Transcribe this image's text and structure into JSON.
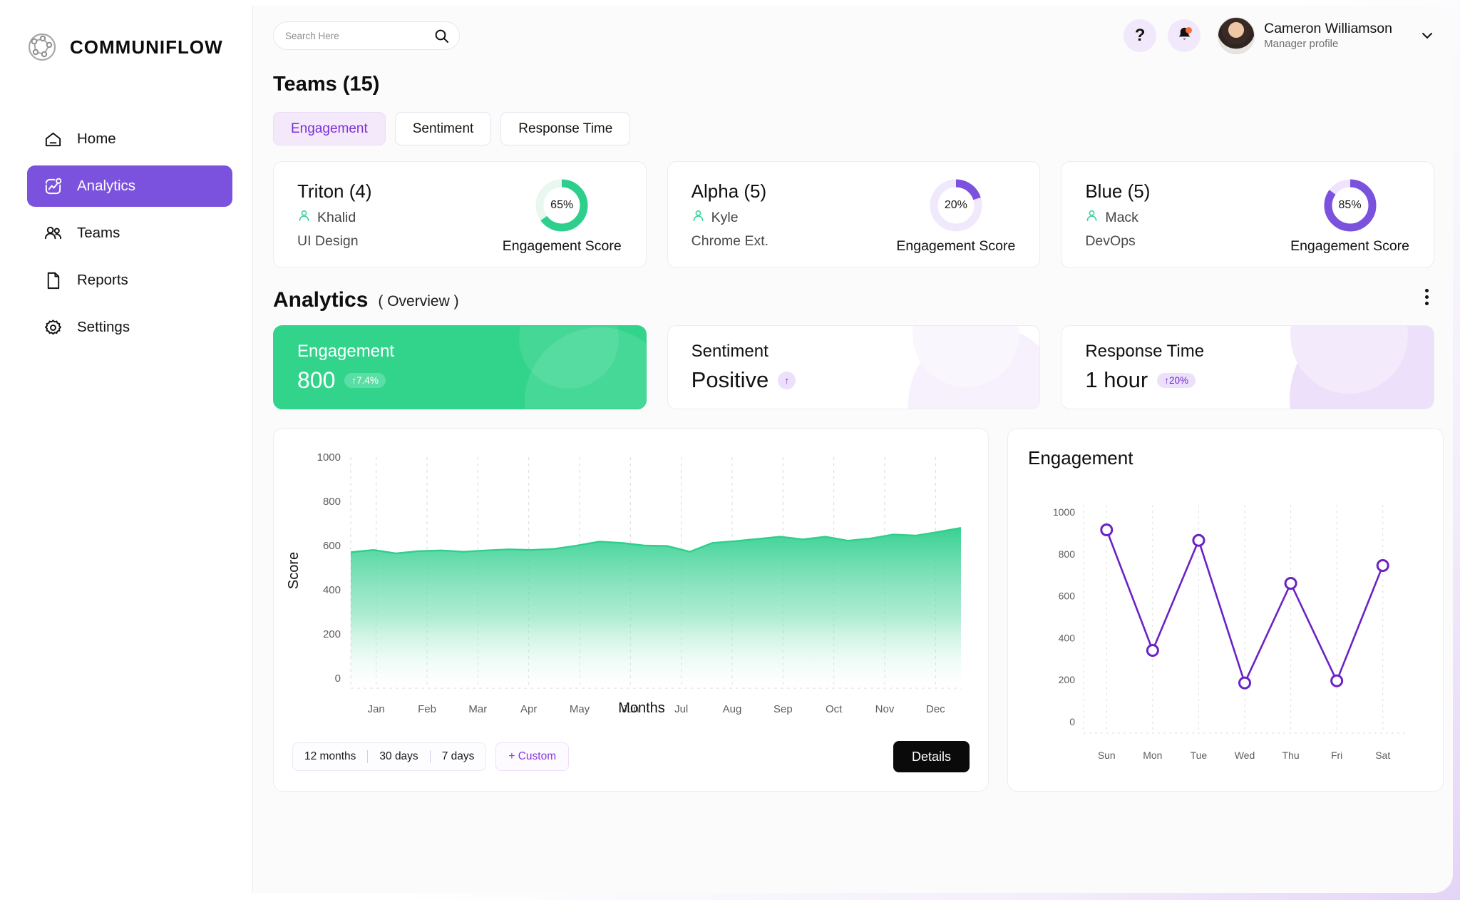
{
  "brand": {
    "name": "COMMUNIFLOW",
    "logo_icon": "network-globe-icon"
  },
  "sidebar": {
    "items": [
      {
        "label": "Home",
        "icon": "home-icon",
        "active": false
      },
      {
        "label": "Analytics",
        "icon": "analytics-chart-icon",
        "active": true
      },
      {
        "label": "Teams",
        "icon": "people-icon",
        "active": false
      },
      {
        "label": "Reports",
        "icon": "document-icon",
        "active": false
      },
      {
        "label": "Settings",
        "icon": "gear-icon",
        "active": false
      }
    ]
  },
  "topbar": {
    "search_placeholder": "Search Here",
    "search_value": "",
    "help_icon": "question-mark-icon",
    "notification_icon": "bell-icon",
    "user_name": "Cameron Williamson",
    "user_role": "Manager profile",
    "chevron_icon": "chevron-down-icon"
  },
  "teams_section": {
    "title": "Teams (15)",
    "tabs": [
      {
        "label": "Engagement",
        "active": true
      },
      {
        "label": "Sentiment",
        "active": false
      },
      {
        "label": "Response Time",
        "active": false
      }
    ],
    "cards": [
      {
        "name": "Triton (4)",
        "lead": "Khalid",
        "tag": "UI Design",
        "percent": "65%",
        "percent_value": 65,
        "metric_label": "Engagement Score",
        "color": "#2ecf8d",
        "track": "#e8f7ef"
      },
      {
        "name": "Alpha (5)",
        "lead": "Kyle",
        "tag": "Chrome Ext.",
        "percent": "20%",
        "percent_value": 20,
        "metric_label": "Engagement Score",
        "color": "#7b52dd",
        "track": "#f0e8fb"
      },
      {
        "name": "Blue (5)",
        "lead": "Mack",
        "tag": "DevOps",
        "percent": "85%",
        "percent_value": 85,
        "metric_label": "Engagement Score",
        "color": "#7b52dd",
        "track": "#efe4fb"
      }
    ]
  },
  "analytics_section": {
    "title": "Analytics",
    "subtitle": "( Overview )",
    "menu_icon": "kebab-menu-icon",
    "kpis": [
      {
        "name": "Engagement",
        "value": "800",
        "badge": "↑7.4%",
        "badge_round": false,
        "theme": "green"
      },
      {
        "name": "Sentiment",
        "value": "Positive",
        "badge": "↑",
        "badge_round": true,
        "theme": "plain"
      },
      {
        "name": "Response Time",
        "value": "1 hour",
        "badge": "↑20%",
        "badge_round": false,
        "theme": "purple"
      }
    ]
  },
  "area_chart_card": {
    "ranges": [
      "12 months",
      "30 days",
      "7 days"
    ],
    "custom_label": "+ Custom",
    "details_label": "Details"
  },
  "line_chart_card": {
    "title": "Engagement"
  },
  "colors": {
    "accent_purple": "#7b52dd",
    "accent_green": "#32d48c",
    "tab_active_text": "#7d2fd6",
    "dark_button": "#0a0a0a"
  },
  "chart_data": [
    {
      "type": "area",
      "title": "",
      "xlabel": "Months",
      "ylabel": "Score",
      "categories": [
        "Jan",
        "Feb",
        "Mar",
        "Apr",
        "May",
        "Jun",
        "Jul",
        "Aug",
        "Sep",
        "Oct",
        "Nov",
        "Dec"
      ],
      "x": [
        "Jan",
        "Feb",
        "Mar",
        "Apr",
        "May",
        "Jun",
        "Jul",
        "Aug",
        "Sep",
        "Oct",
        "Nov",
        "Dec"
      ],
      "values": [
        570,
        578,
        572,
        580,
        583,
        600,
        615,
        605,
        628,
        625,
        648,
        678
      ],
      "detail_values": [
        570,
        580,
        565,
        575,
        578,
        572,
        578,
        583,
        580,
        585,
        600,
        618,
        612,
        600,
        598,
        572,
        612,
        620,
        630,
        640,
        628,
        640,
        622,
        632,
        650,
        645,
        662,
        680
      ],
      "ylim": [
        0,
        1000
      ],
      "yticks": [
        0,
        200,
        400,
        600,
        800,
        1000
      ],
      "grid": true,
      "legend": "none",
      "series_color": "#2ecf8d",
      "fill": "gradient-green-to-white"
    },
    {
      "type": "line",
      "title": "Engagement",
      "xlabel": "",
      "ylabel": "",
      "categories": [
        "Sun",
        "Mon",
        "Tue",
        "Wed",
        "Thu",
        "Fri",
        "Sat"
      ],
      "x": [
        "Sun",
        "Mon",
        "Tue",
        "Wed",
        "Thu",
        "Fri",
        "Sat"
      ],
      "values": [
        915,
        340,
        865,
        185,
        660,
        195,
        745
      ],
      "ylim": [
        0,
        1000
      ],
      "yticks": [
        0,
        200,
        400,
        600,
        800,
        1000
      ],
      "grid": true,
      "legend": "none",
      "series_color": "#6a22c4",
      "marker": "open-circle"
    }
  ]
}
